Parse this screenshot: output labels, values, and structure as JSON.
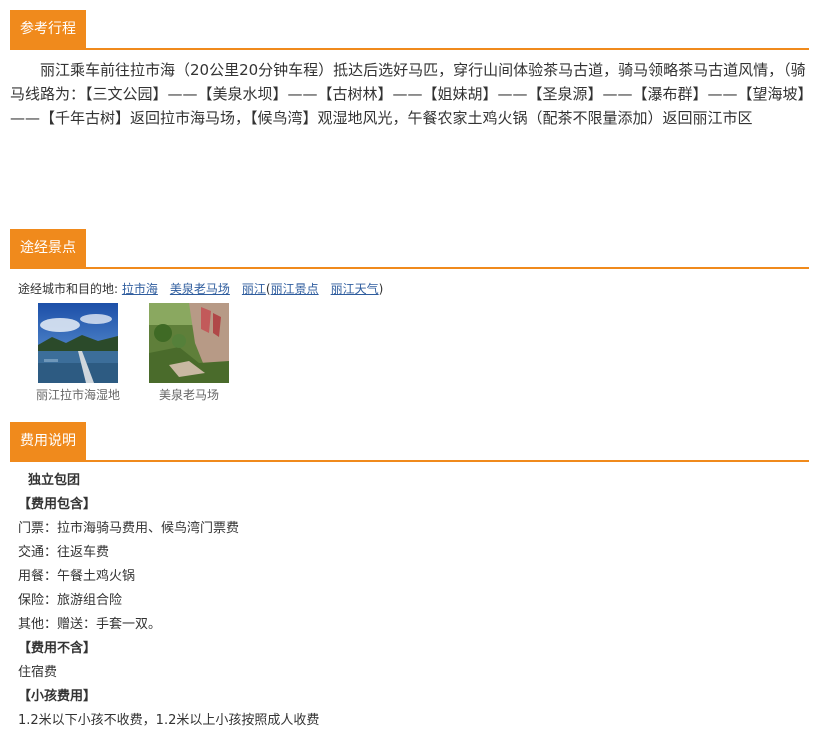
{
  "itinerary": {
    "title": "参考行程",
    "text": "丽江乘车前往拉市海（20公里20分钟车程）抵达后选好马匹，穿行山间体验茶马古道，骑马领略茶马古道风情，（骑马线路为：【三文公园】——【美泉水坝】——【古树林】——【姐妹胡】——【圣泉源】——【瀑布群】——【望海坡】——【千年古树】返回拉市海马场，【候鸟湾】观湿地风光，午餐农家土鸡火锅（配茶不限量添加）返回丽江市区"
  },
  "spots": {
    "title": "途经景点",
    "route_label": "途经城市和目的地:",
    "links": [
      "拉市海",
      "美泉老马场",
      "丽江",
      "丽江景点",
      "丽江天气"
    ],
    "paren_open": "(",
    "paren_close": ")",
    "photos": [
      {
        "caption": "丽江拉市海湿地",
        "icon": "lake-photo"
      },
      {
        "caption": "美泉老马场",
        "icon": "mountain-photo"
      }
    ]
  },
  "fees": {
    "title": "费用说明",
    "package": "独立包团",
    "included_header": "【费用包含】",
    "included": [
      "门票：拉市海骑马费用、候鸟湾门票费",
      "交通：往返车费",
      "用餐：午餐土鸡火锅",
      "保险：旅游组合险",
      "其他：赠送：手套一双。"
    ],
    "excluded_header": "【费用不含】",
    "excluded": [
      "住宿费"
    ],
    "child_header": "【小孩费用】",
    "child": [
      "1.2米以下小孩不收费，1.2米以上小孩按照成人收费"
    ]
  },
  "colors": {
    "accent": "#f08a1c",
    "link": "#2f5d9e"
  }
}
